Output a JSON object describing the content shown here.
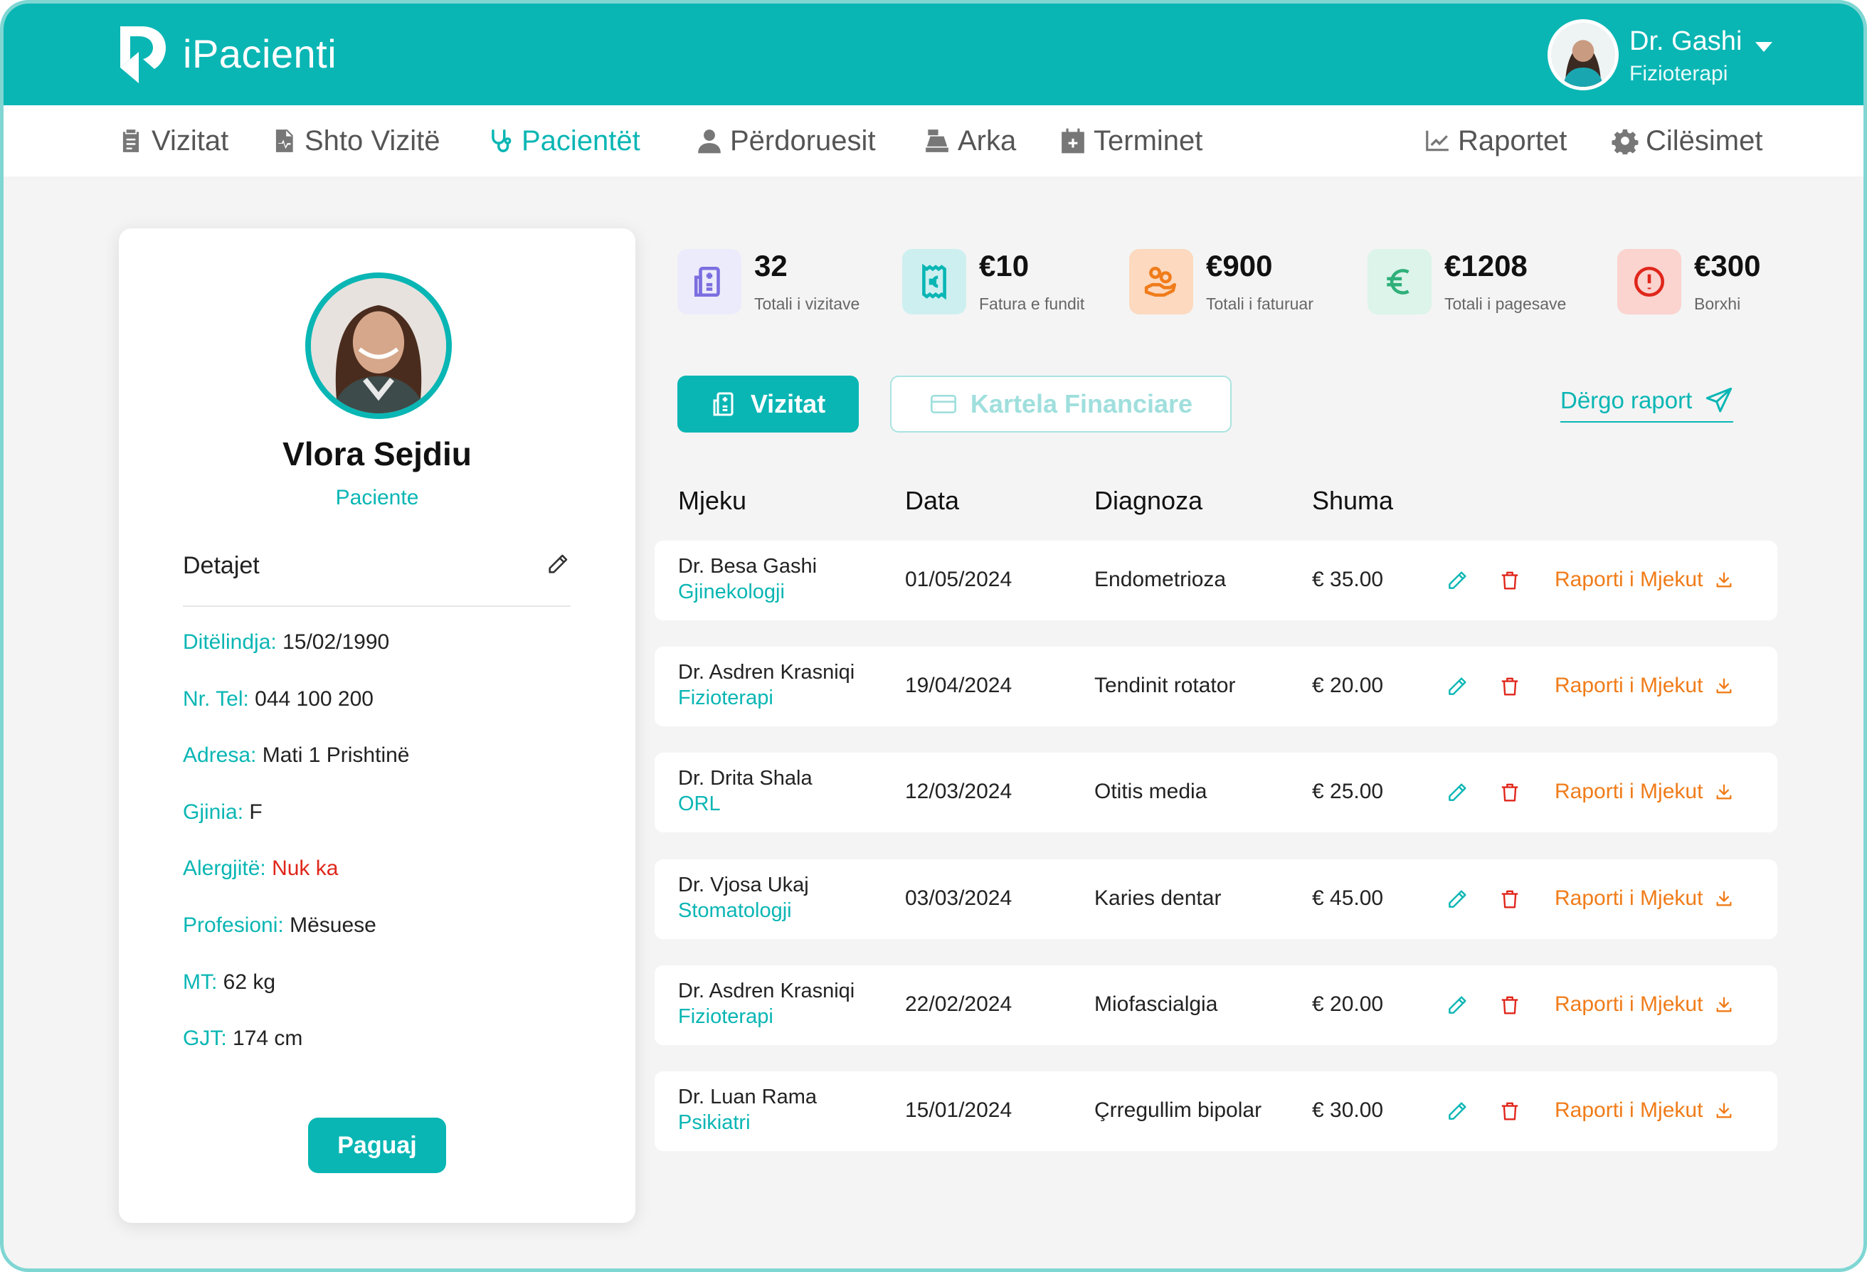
{
  "app": {
    "brand": "iPacienti",
    "brand_color": "#09b6b4"
  },
  "user": {
    "name": "Dr. Gashi",
    "role": "Fizioterapi"
  },
  "nav": {
    "vizitat": "Vizitat",
    "shto_vizite": "Shto Vizitë",
    "pacientet": "Pacientët",
    "perdoruesit": "Përdoruesit",
    "arka": "Arka",
    "terminet": "Terminet",
    "raportet": "Raportet",
    "cilesimet": "Cilësimet"
  },
  "patient": {
    "name": "Vlora Sejdiu",
    "role": "Paciente",
    "details_title": "Detajet",
    "details": [
      {
        "label": "Ditëlindja:",
        "value": "15/02/1990"
      },
      {
        "label": "Nr. Tel:",
        "value": "044 100 200"
      },
      {
        "label": "Adresa:",
        "value": "Mati 1 Prishtinë"
      },
      {
        "label": "Gjinia:",
        "value": "F"
      },
      {
        "label": "Alergjitë:",
        "value": "Nuk ka"
      },
      {
        "label": "Profesioni:",
        "value": "Mësuese"
      },
      {
        "label": "MT:",
        "value": "62 kg"
      },
      {
        "label": "GJT:",
        "value": "174 cm"
      }
    ],
    "pay_label": "Paguaj"
  },
  "stats": [
    {
      "value": "32",
      "label": "Totali i vizitave",
      "icon": "hospital-icon",
      "color": "#7b6ee0",
      "bg": "#ecebfb"
    },
    {
      "value": "€10",
      "label": "Fatura e fundit",
      "icon": "receipt-icon",
      "color": "#09b6b4",
      "bg": "#cdeff0"
    },
    {
      "value": "€900",
      "label": "Totali i faturuar",
      "icon": "hand-coins-icon",
      "color": "#f07c1a",
      "bg": "#fcd9bf"
    },
    {
      "value": "€1208",
      "label": "Totali i pagesave",
      "icon": "euro-icon",
      "color": "#2fb07a",
      "bg": "#dcf4ea"
    },
    {
      "value": "€300",
      "label": "Borxhi",
      "icon": "alert-icon",
      "color": "#e0261b",
      "bg": "#fbd3cf"
    }
  ],
  "tabs": {
    "active": "Vizitat",
    "inactive": "Kartela Financiare"
  },
  "send_report": "Dërgo raport",
  "table": {
    "headers": {
      "doctor": "Mjeku",
      "date": "Data",
      "diagnosis": "Diagnoza",
      "amount": "Shuma"
    },
    "report_label": "Raporti i Mjekut",
    "rows": [
      {
        "doctor": "Dr. Besa Gashi",
        "specialty": "Gjinekologji",
        "date": "01/05/2024",
        "diagnosis": "Endometrioza",
        "amount": "€ 35.00"
      },
      {
        "doctor": "Dr. Asdren Krasniqi",
        "specialty": "Fizioterapi",
        "date": "19/04/2024",
        "diagnosis": "Tendinit rotator",
        "amount": "€ 20.00"
      },
      {
        "doctor": "Dr. Drita Shala",
        "specialty": "ORL",
        "date": "12/03/2024",
        "diagnosis": "Otitis media",
        "amount": "€ 25.00"
      },
      {
        "doctor": "Dr. Vjosa Ukaj",
        "specialty": "Stomatologji",
        "date": "03/03/2024",
        "diagnosis": "Karies dentar",
        "amount": "€ 45.00"
      },
      {
        "doctor": "Dr. Asdren Krasniqi",
        "specialty": "Fizioterapi",
        "date": "22/02/2024",
        "diagnosis": "Miofascialgia",
        "amount": "€ 20.00"
      },
      {
        "doctor": "Dr. Luan Rama",
        "specialty": "Psikiatri",
        "date": "15/01/2024",
        "diagnosis": "Çrregullim bipolar",
        "amount": "€ 30.00"
      }
    ]
  }
}
